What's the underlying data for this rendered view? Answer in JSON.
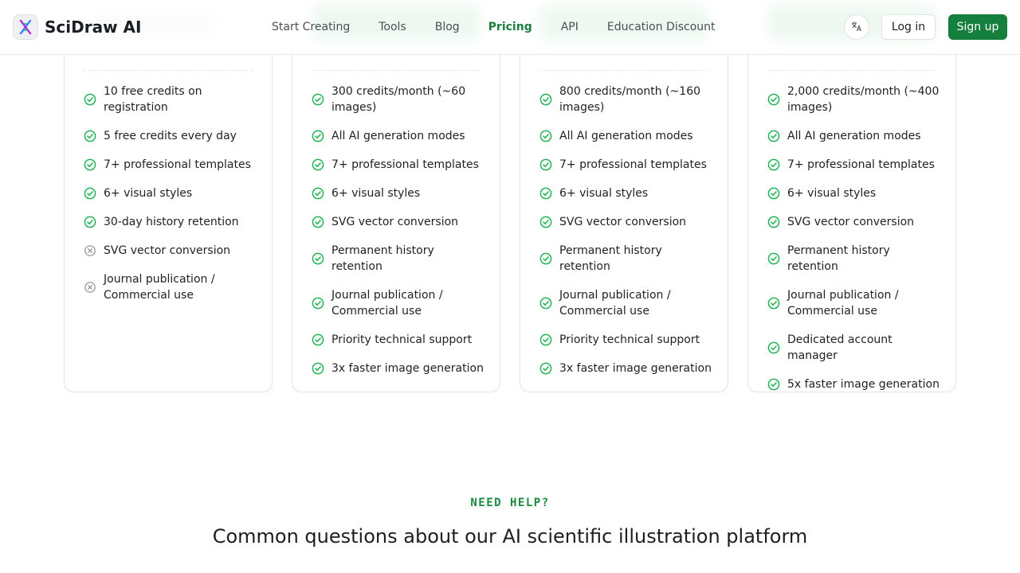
{
  "header": {
    "brand": "SciDraw AI",
    "nav": [
      {
        "label": "Start Creating",
        "active": false
      },
      {
        "label": "Tools",
        "active": false
      },
      {
        "label": "Blog",
        "active": false
      },
      {
        "label": "Pricing",
        "active": true
      },
      {
        "label": "API",
        "active": false
      },
      {
        "label": "Education Discount",
        "active": false
      }
    ],
    "login_label": "Log in",
    "signup_label": "Sign up",
    "icons": {
      "logo": "dna-helix-icon",
      "language": "translate-icon"
    }
  },
  "plans": [
    {
      "features": [
        {
          "text": "10 free credits on registration",
          "included": true
        },
        {
          "text": "5 free credits every day",
          "included": true
        },
        {
          "text": "7+ professional templates",
          "included": true
        },
        {
          "text": "6+ visual styles",
          "included": true
        },
        {
          "text": "30-day history retention",
          "included": true
        },
        {
          "text": "SVG vector conversion",
          "included": false
        },
        {
          "text": "Journal publication / Commercial use",
          "included": false
        }
      ]
    },
    {
      "features": [
        {
          "text": "300 credits/month (~60 images)",
          "included": true
        },
        {
          "text": "All AI generation modes",
          "included": true
        },
        {
          "text": "7+ professional templates",
          "included": true
        },
        {
          "text": "6+ visual styles",
          "included": true
        },
        {
          "text": "SVG vector conversion",
          "included": true
        },
        {
          "text": "Permanent history retention",
          "included": true
        },
        {
          "text": "Journal publication / Commercial use",
          "included": true
        },
        {
          "text": "Priority technical support",
          "included": true
        },
        {
          "text": "3x faster image generation",
          "included": true
        }
      ]
    },
    {
      "features": [
        {
          "text": "800 credits/month (~160 images)",
          "included": true
        },
        {
          "text": "All AI generation modes",
          "included": true
        },
        {
          "text": "7+ professional templates",
          "included": true
        },
        {
          "text": "6+ visual styles",
          "included": true
        },
        {
          "text": "SVG vector conversion",
          "included": true
        },
        {
          "text": "Permanent history retention",
          "included": true
        },
        {
          "text": "Journal publication / Commercial use",
          "included": true
        },
        {
          "text": "Priority technical support",
          "included": true
        },
        {
          "text": "3x faster image generation",
          "included": true
        }
      ]
    },
    {
      "features": [
        {
          "text": "2,000 credits/month (~400 images)",
          "included": true
        },
        {
          "text": "All AI generation modes",
          "included": true
        },
        {
          "text": "7+ professional templates",
          "included": true
        },
        {
          "text": "6+ visual styles",
          "included": true
        },
        {
          "text": "SVG vector conversion",
          "included": true
        },
        {
          "text": "Permanent history retention",
          "included": true
        },
        {
          "text": "Journal publication / Commercial use",
          "included": true
        },
        {
          "text": "Dedicated account manager",
          "included": true
        },
        {
          "text": "5x faster image generation",
          "included": true
        }
      ]
    }
  ],
  "faq": {
    "eyebrow": "NEED HELP?",
    "title": "Common questions about our AI scientific illustration platform"
  },
  "colors": {
    "accent": "#15803d",
    "check": "#22b455",
    "excluded": "#8a8f94"
  }
}
